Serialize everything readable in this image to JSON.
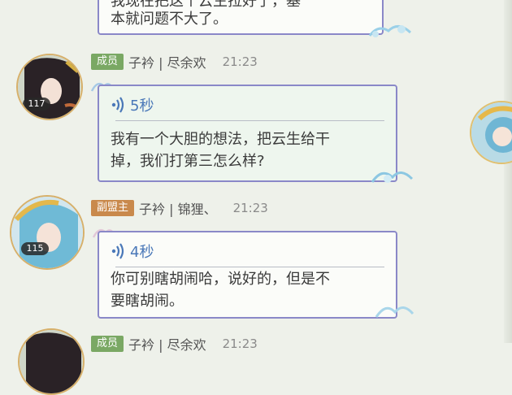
{
  "messages": [
    {
      "text": "我现在把这个云生拉好了，基本就问题不大了。"
    },
    {
      "badge": "成员",
      "sender": "子衿 | 尽余欢",
      "time": "21:23",
      "level": "117",
      "voice": "5秒",
      "text_line1": "我有一个大胆的想法，把云生给干",
      "text_line2": "掉，我们打第三怎么样?"
    },
    {
      "badge": "副盟主",
      "sender": "子衿 | 锦狸、",
      "time": "21:23",
      "level": "115",
      "voice": "4秒",
      "text_line1": "你可别瞎胡闹哈，说好的，但是不",
      "text_line2": "要瞎胡闹。"
    },
    {
      "badge": "成员",
      "sender": "子衿 | 尽余欢",
      "time": "21:23"
    }
  ],
  "top_line1": "我现在把这个云生拉好了，基",
  "top_line2": "本就问题不大了。",
  "colors": {
    "accent": "#4a78b8",
    "bubble_border": "#8a88c8",
    "member_badge": "#7aa864",
    "vice_badge": "#c9894c"
  }
}
